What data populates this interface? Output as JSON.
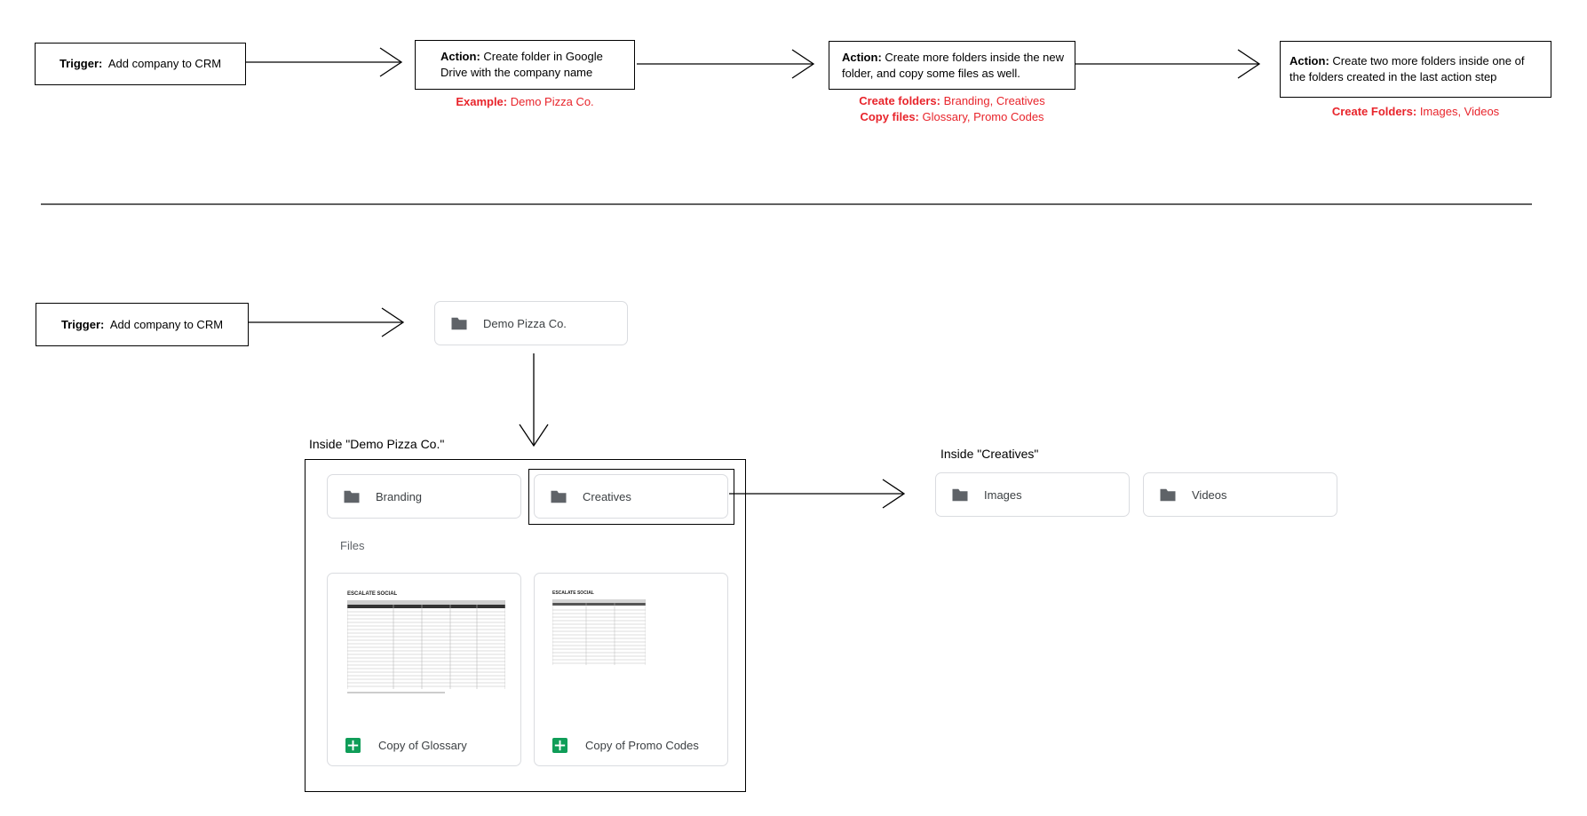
{
  "top_flow": {
    "trigger": {
      "bold": "Trigger:",
      "text": "Add company to CRM"
    },
    "action1": {
      "bold": "Action:",
      "text": "Create folder in Google Drive with the company name"
    },
    "action1_note": {
      "bold": "Example:",
      "text": "Demo Pizza Co."
    },
    "action2": {
      "bold": "Action:",
      "text": "Create more folders inside the new folder, and copy some files as well."
    },
    "action2_note_1": {
      "bold": "Create folders:",
      "text": "Branding, Creatives"
    },
    "action2_note_2": {
      "bold": "Copy files:",
      "text": "Glossary, Promo Codes"
    },
    "action3": {
      "bold": "Action:",
      "text": "Create two more folders inside one of the folders created in the last action step"
    },
    "action3_note": {
      "bold": "Create Folders:",
      "text": "Images, Videos"
    }
  },
  "bottom_flow": {
    "trigger": {
      "bold": "Trigger:",
      "text": "Add company to CRM"
    },
    "root_folder": "Demo Pizza Co.",
    "inside_root_label": "Inside \"Demo Pizza Co.\"",
    "subfolders": [
      "Branding",
      "Creatives"
    ],
    "files_label": "Files",
    "files": [
      "Copy of Glossary",
      "Copy of Promo Codes"
    ],
    "inside_creatives_label": "Inside \"Creatives\"",
    "creatives_subfolders": [
      "Images",
      "Videos"
    ],
    "thumb_logo": "ESCALATE SOCIAL"
  },
  "colors": {
    "note_red": "#e8242b",
    "folder_grey": "#5f6368",
    "sheets_green": "#0f9d58",
    "card_border": "#dadce0"
  }
}
